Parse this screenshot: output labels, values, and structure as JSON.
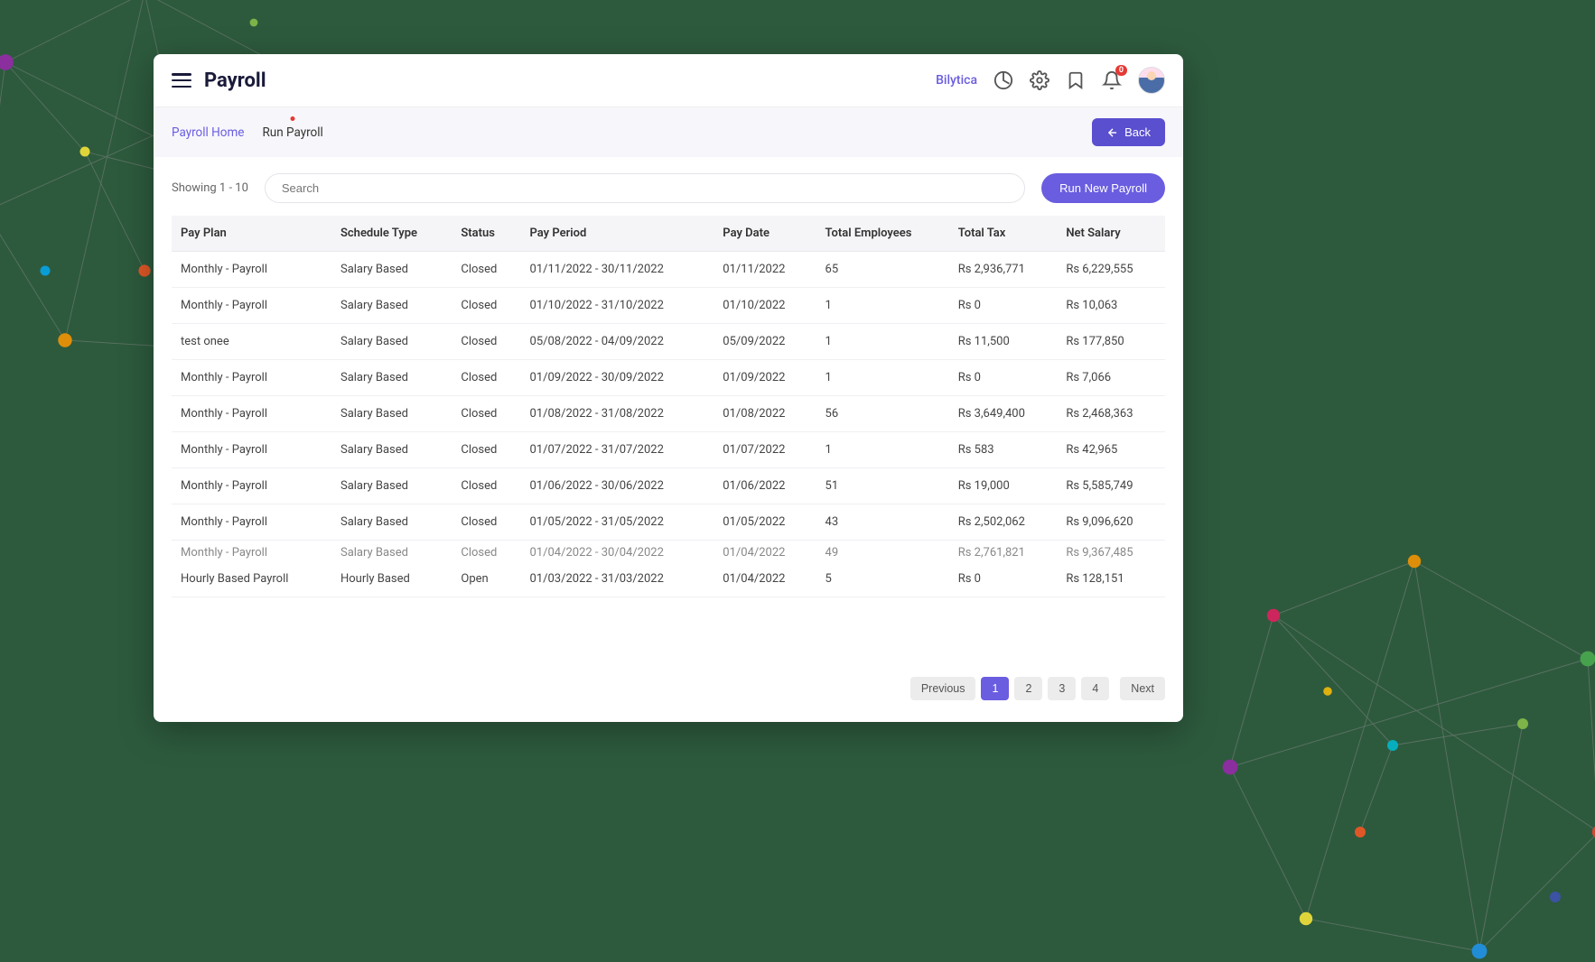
{
  "header": {
    "title": "Payroll",
    "brand": "Bilytica",
    "notification_count": "0"
  },
  "breadcrumb": {
    "home": "Payroll Home",
    "current": "Run Payroll"
  },
  "back_btn": "Back",
  "toolbar": {
    "showing": "Showing 1 - 10",
    "search_placeholder": "Search",
    "run_label": "Run New Payroll"
  },
  "columns": [
    "Pay Plan",
    "Schedule Type",
    "Status",
    "Pay Period",
    "Pay Date",
    "Total Employees",
    "Total Tax",
    "Net Salary"
  ],
  "rows": [
    {
      "plan": "Monthly - Payroll",
      "type": "Salary Based",
      "status": "Closed",
      "period": "01/11/2022 - 30/11/2022",
      "date": "01/11/2022",
      "emp": "65",
      "tax": "Rs 2,936,771",
      "net": "Rs 6,229,555"
    },
    {
      "plan": "Monthly - Payroll",
      "type": "Salary Based",
      "status": "Closed",
      "period": "01/10/2022 - 31/10/2022",
      "date": "01/10/2022",
      "emp": "1",
      "tax": "Rs 0",
      "net": "Rs 10,063"
    },
    {
      "plan": "test onee",
      "type": "Salary Based",
      "status": "Closed",
      "period": "05/08/2022 - 04/09/2022",
      "date": "05/09/2022",
      "emp": "1",
      "tax": "Rs 11,500",
      "net": "Rs 177,850"
    },
    {
      "plan": "Monthly - Payroll",
      "type": "Salary Based",
      "status": "Closed",
      "period": "01/09/2022 - 30/09/2022",
      "date": "01/09/2022",
      "emp": "1",
      "tax": "Rs 0",
      "net": "Rs 7,066"
    },
    {
      "plan": "Monthly - Payroll",
      "type": "Salary Based",
      "status": "Closed",
      "period": "01/08/2022 - 31/08/2022",
      "date": "01/08/2022",
      "emp": "56",
      "tax": "Rs 3,649,400",
      "net": "Rs 2,468,363"
    },
    {
      "plan": "Monthly - Payroll",
      "type": "Salary Based",
      "status": "Closed",
      "period": "01/07/2022 - 31/07/2022",
      "date": "01/07/2022",
      "emp": "1",
      "tax": "Rs 583",
      "net": "Rs 42,965"
    },
    {
      "plan": "Monthly - Payroll",
      "type": "Salary Based",
      "status": "Closed",
      "period": "01/06/2022 - 30/06/2022",
      "date": "01/06/2022",
      "emp": "51",
      "tax": "Rs 19,000",
      "net": "Rs 5,585,749"
    },
    {
      "plan": "Monthly - Payroll",
      "type": "Salary Based",
      "status": "Closed",
      "period": "01/05/2022 - 31/05/2022",
      "date": "01/05/2022",
      "emp": "43",
      "tax": "Rs 2,502,062",
      "net": "Rs 9,096,620"
    },
    {
      "plan": "Monthly - Payroll",
      "type": "Salary Based",
      "status": "Closed",
      "period": "01/04/2022 - 30/04/2022",
      "date": "01/04/2022",
      "emp": "49",
      "tax": "Rs 2,761,821",
      "net": "Rs 9,367,485"
    },
    {
      "plan": "Hourly Based Payroll",
      "type": "Hourly Based",
      "status": "Open",
      "period": "01/03/2022 - 31/03/2022",
      "date": "01/04/2022",
      "emp": "5",
      "tax": "Rs 0",
      "net": "Rs 128,151"
    }
  ],
  "pagination": {
    "prev": "Previous",
    "pages": [
      "1",
      "2",
      "3",
      "4"
    ],
    "active": "1",
    "next": "Next"
  }
}
